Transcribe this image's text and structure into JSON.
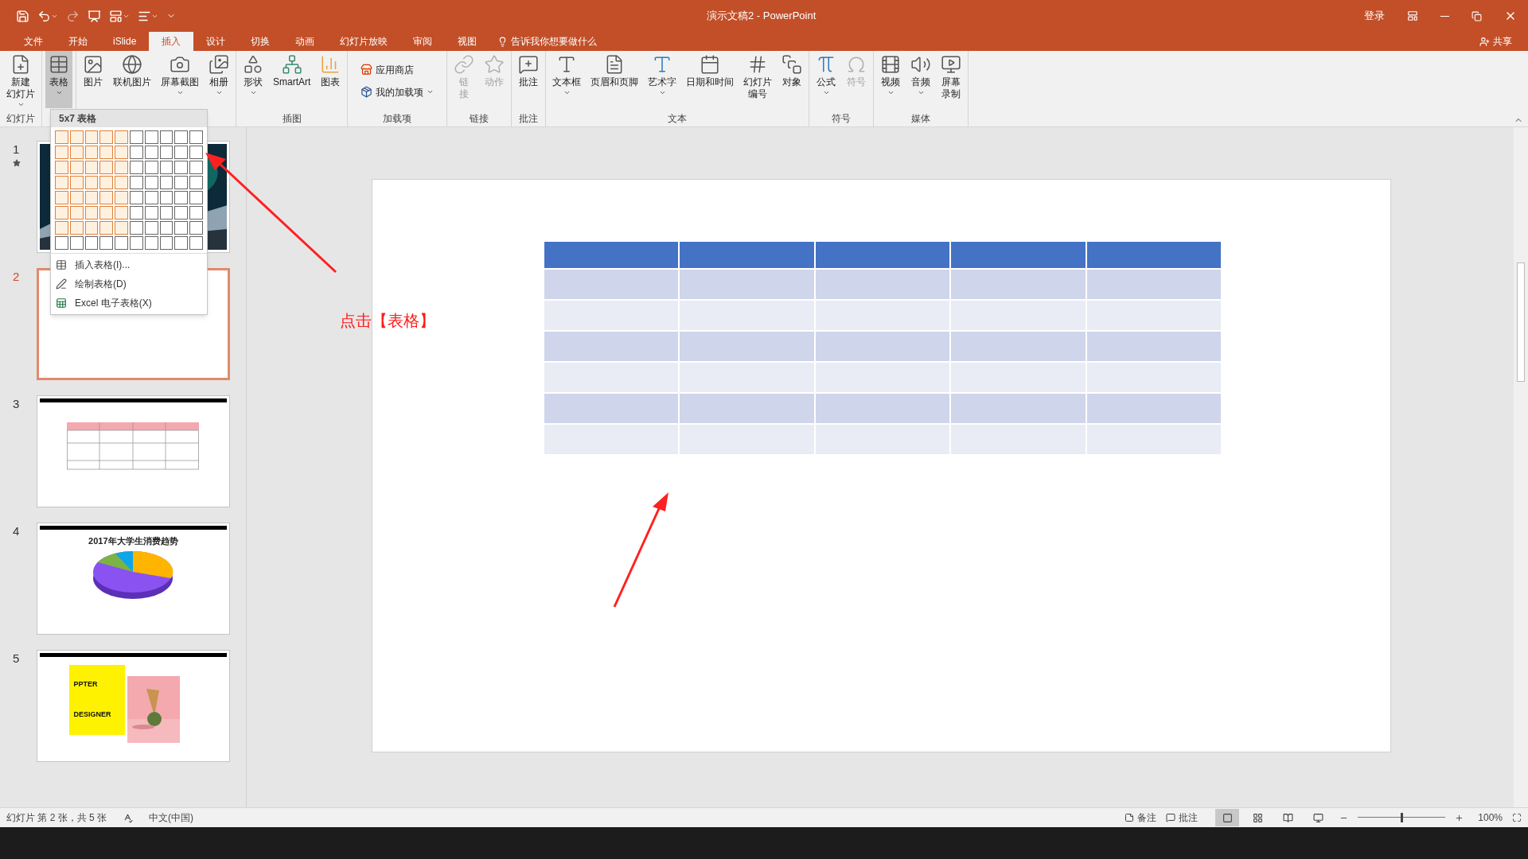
{
  "title_bar": {
    "title": "演示文稿2 - PowerPoint",
    "sign_in": "登录",
    "quick_access": [
      {
        "kind": "save",
        "disabled": false,
        "dropdown": false
      },
      {
        "kind": "undo",
        "disabled": false,
        "dropdown": true
      },
      {
        "kind": "redo",
        "disabled": true,
        "dropdown": false
      },
      {
        "kind": "start",
        "disabled": false,
        "dropdown": false
      },
      {
        "kind": "layout",
        "disabled": false,
        "dropdown": true
      },
      {
        "kind": "arrange",
        "disabled": false,
        "dropdown": true
      },
      {
        "kind": "customize",
        "disabled": false,
        "dropdown": false
      }
    ]
  },
  "tabs": [
    {
      "label": "文件",
      "selected": false
    },
    {
      "label": "开始",
      "selected": false
    },
    {
      "label": "iSlide",
      "selected": false
    },
    {
      "label": "插入",
      "selected": true
    },
    {
      "label": "设计",
      "selected": false
    },
    {
      "label": "切换",
      "selected": false
    },
    {
      "label": "动画",
      "selected": false
    },
    {
      "label": "幻灯片放映",
      "selected": false
    },
    {
      "label": "审阅",
      "selected": false
    },
    {
      "label": "视图",
      "selected": false
    }
  ],
  "tell_me": "告诉我你想要做什么",
  "share": "共享",
  "ribbon": {
    "groups": [
      {
        "label": "幻灯片",
        "buttons": [
          {
            "kind": "new-slide",
            "lines": [
              "新建",
              "幻灯片"
            ],
            "dropdown": true,
            "disabled": false,
            "selected": false
          }
        ]
      },
      {
        "buttons": [
          {
            "kind": "table",
            "lines": [
              "表格"
            ],
            "dropdown": true,
            "disabled": false,
            "selected": true
          }
        ]
      },
      {
        "buttons": [
          {
            "kind": "picture",
            "lines": [
              "图片"
            ],
            "dropdown": false,
            "disabled": false,
            "selected": false
          },
          {
            "kind": "online-picture",
            "lines": [
              "联机图片"
            ],
            "dropdown": false,
            "disabled": false,
            "selected": false
          },
          {
            "kind": "screenshot",
            "lines": [
              "屏幕截图"
            ],
            "dropdown": true,
            "disabled": false,
            "selected": false
          },
          {
            "kind": "album",
            "lines": [
              "相册"
            ],
            "dropdown": true,
            "disabled": false,
            "selected": false
          }
        ]
      },
      {
        "label": "插图",
        "buttons": [
          {
            "kind": "shapes",
            "lines": [
              "形状"
            ],
            "dropdown": true,
            "disabled": false,
            "selected": false
          },
          {
            "kind": "smartart",
            "lines": [
              "SmartArt"
            ],
            "dropdown": false,
            "disabled": false,
            "selected": false
          },
          {
            "kind": "chart",
            "lines": [
              "图表"
            ],
            "dropdown": false,
            "disabled": false,
            "selected": false
          }
        ]
      },
      {
        "label": "加载项",
        "buttons": [
          {
            "kind": "store",
            "lines": [
              "应用商店"
            ],
            "dropdown": false,
            "disabled": false,
            "selected": false
          },
          {
            "kind": "addins",
            "lines": [
              "我的加载项"
            ],
            "dropdown": true,
            "disabled": false,
            "selected": false
          }
        ]
      },
      {
        "label": "链接",
        "buttons": [
          {
            "kind": "link",
            "lines": [
              "链",
              "接"
            ],
            "dropdown": false,
            "disabled": true,
            "selected": false
          },
          {
            "kind": "action",
            "lines": [
              "动作"
            ],
            "dropdown": false,
            "disabled": true,
            "selected": false
          }
        ]
      },
      {
        "label": "批注",
        "buttons": [
          {
            "kind": "comment",
            "lines": [
              "批注"
            ],
            "dropdown": false,
            "disabled": false,
            "selected": false
          }
        ]
      },
      {
        "label": "文本",
        "buttons": [
          {
            "kind": "textbox",
            "lines": [
              "文本框"
            ],
            "dropdown": true,
            "disabled": false,
            "selected": false
          },
          {
            "kind": "header",
            "lines": [
              "页眉和页脚"
            ],
            "dropdown": false,
            "disabled": false,
            "selected": false
          },
          {
            "kind": "wordart",
            "lines": [
              "艺术字"
            ],
            "dropdown": true,
            "disabled": false,
            "selected": false
          },
          {
            "kind": "datetime",
            "lines": [
              "日期和时间"
            ],
            "dropdown": false,
            "disabled": false,
            "selected": false
          },
          {
            "kind": "slide-number",
            "lines": [
              "幻灯片",
              "编号"
            ],
            "dropdown": false,
            "disabled": false,
            "selected": false
          },
          {
            "kind": "object",
            "lines": [
              "对象"
            ],
            "dropdown": false,
            "disabled": false,
            "selected": false
          }
        ]
      },
      {
        "label": "符号",
        "buttons": [
          {
            "kind": "equation",
            "lines": [
              "公式"
            ],
            "dropdown": true,
            "disabled": false,
            "selected": false
          },
          {
            "kind": "symbol",
            "lines": [
              "符号"
            ],
            "dropdown": false,
            "disabled": true,
            "selected": false
          }
        ]
      },
      {
        "label": "媒体",
        "buttons": [
          {
            "kind": "video",
            "lines": [
              "视频"
            ],
            "dropdown": true,
            "disabled": false,
            "selected": false
          },
          {
            "kind": "audio",
            "lines": [
              "音频"
            ],
            "dropdown": true,
            "disabled": false,
            "selected": false
          },
          {
            "kind": "record",
            "lines": [
              "屏幕",
              "录制"
            ],
            "dropdown": false,
            "disabled": false,
            "selected": false
          }
        ]
      }
    ]
  },
  "table_menu": {
    "title": "5x7 表格",
    "grid": [
      [
        true,
        true,
        true,
        true,
        true,
        false,
        false,
        false,
        false,
        false
      ],
      [
        true,
        true,
        true,
        true,
        true,
        false,
        false,
        false,
        false,
        false
      ],
      [
        true,
        true,
        true,
        true,
        true,
        false,
        false,
        false,
        false,
        false
      ],
      [
        true,
        true,
        true,
        true,
        true,
        false,
        false,
        false,
        false,
        false
      ],
      [
        true,
        true,
        true,
        true,
        true,
        false,
        false,
        false,
        false,
        false
      ],
      [
        true,
        true,
        true,
        true,
        true,
        false,
        false,
        false,
        false,
        false
      ],
      [
        true,
        true,
        true,
        true,
        true,
        false,
        false,
        false,
        false,
        false
      ],
      [
        false,
        false,
        false,
        false,
        false,
        false,
        false,
        false,
        false,
        false
      ]
    ],
    "items": [
      {
        "kind": "insert",
        "label": "插入表格(I)..."
      },
      {
        "kind": "draw",
        "label": "绘制表格(D)"
      },
      {
        "kind": "excel",
        "label": "Excel 电子表格(X)"
      }
    ]
  },
  "slides": [
    {
      "number": "1",
      "starred": true,
      "selected": false,
      "kind": "aurora"
    },
    {
      "number": "2",
      "starred": false,
      "selected": true,
      "kind": "blank"
    },
    {
      "number": "3",
      "starred": false,
      "selected": false,
      "kind": "table"
    },
    {
      "number": "4",
      "starred": false,
      "selected": false,
      "kind": "pie",
      "title": "2017年大学生消费趋势"
    },
    {
      "number": "5",
      "starred": false,
      "selected": false,
      "kind": "cards",
      "texts": [
        "PPTER",
        "DESIGNER"
      ]
    }
  ],
  "slide": {
    "table": {
      "columns": [
        {
          "kind": "empty"
        },
        {
          "kind": "empty"
        },
        {
          "kind": "empty"
        },
        {
          "kind": "empty"
        },
        {
          "kind": "empty"
        }
      ],
      "rows": [
        {
          "color": "#4472c4"
        },
        {
          "color": "#cfd5ea"
        },
        {
          "color": "#e9ebf5"
        },
        {
          "color": "#cfd5ea"
        },
        {
          "color": "#e9ebf5"
        },
        {
          "color": "#cfd5ea"
        },
        {
          "color": "#e9ebf5"
        }
      ]
    }
  },
  "annotation": "点击【表格】",
  "status_bar": {
    "slide_info": "幻灯片 第 2 张，共 5 张",
    "language": "中文(中国)",
    "notes": "备注",
    "comments": "批注",
    "views": [
      {
        "kind": "normal",
        "selected": true
      },
      {
        "kind": "sorter",
        "selected": false
      },
      {
        "kind": "reading",
        "selected": false
      },
      {
        "kind": "show",
        "selected": false
      }
    ],
    "zoom": {
      "level": 0.5,
      "reading": "100%"
    }
  }
}
